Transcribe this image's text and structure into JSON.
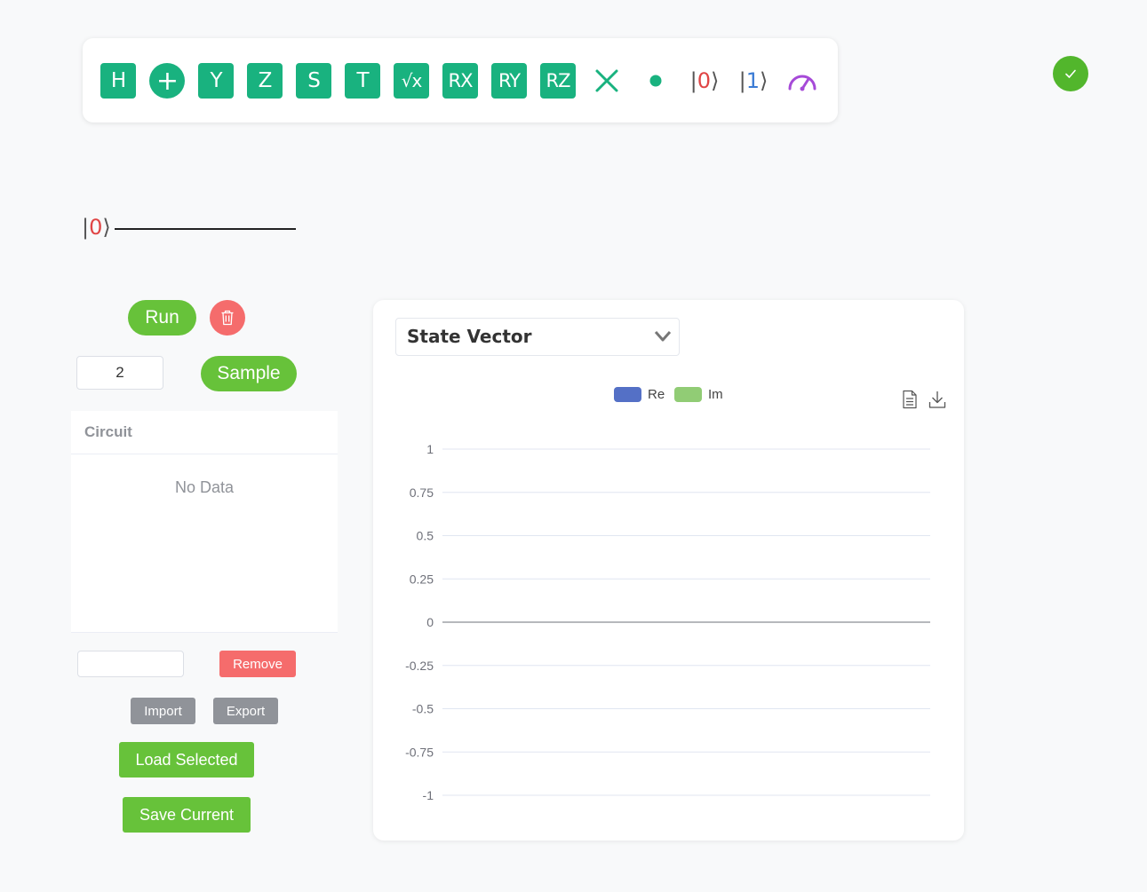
{
  "toolbar": {
    "gates": [
      {
        "label": "H",
        "icon": "hadamard-gate"
      },
      {
        "label": "+",
        "icon": "cnot-target-gate"
      },
      {
        "label": "Y",
        "icon": "pauli-y-gate"
      },
      {
        "label": "Z",
        "icon": "pauli-z-gate"
      },
      {
        "label": "S",
        "icon": "s-gate"
      },
      {
        "label": "T",
        "icon": "t-gate"
      },
      {
        "label": "√x",
        "icon": "sqrt-x-gate"
      },
      {
        "label": "RX",
        "icon": "rx-gate"
      },
      {
        "label": "RY",
        "icon": "ry-gate"
      },
      {
        "label": "RZ",
        "icon": "rz-gate"
      }
    ],
    "ket0": {
      "open": "|",
      "value": "0",
      "close": "⟩"
    },
    "ket1": {
      "open": "|",
      "value": "1",
      "close": "⟩"
    },
    "icons": [
      "swap-x-icon",
      "control-dot-icon",
      "ket-zero-icon",
      "ket-one-icon",
      "measure-gauge-icon"
    ]
  },
  "status": {
    "icon": "check-icon",
    "color": "#52b62c"
  },
  "circuit": {
    "qubit_label": {
      "open": "|",
      "value": "0",
      "close": "⟩"
    }
  },
  "controls": {
    "run_label": "Run",
    "clear_icon": "trash-icon",
    "shots_value": "2",
    "sample_label": "Sample"
  },
  "circuit_table": {
    "header": "Circuit",
    "empty_text": "No Data"
  },
  "actions": {
    "name_value": "",
    "remove_label": "Remove",
    "import_label": "Import",
    "export_label": "Export",
    "load_label": "Load Selected",
    "save_label": "Save Current"
  },
  "chart_panel": {
    "selected_view": "State Vector",
    "toolbox_icons": [
      "data-view-icon",
      "download-icon"
    ]
  },
  "chart_data": {
    "type": "bar",
    "title": "",
    "categories": [],
    "series": [
      {
        "name": "Re",
        "color": "#5470c6",
        "values": []
      },
      {
        "name": "Im",
        "color": "#91cc75",
        "values": []
      }
    ],
    "ylim": [
      -1,
      1
    ],
    "yticks": [
      "1",
      "0.75",
      "0.5",
      "0.25",
      "0",
      "-0.25",
      "-0.5",
      "-0.75",
      "-1"
    ],
    "ytick_values": [
      1,
      0.75,
      0.5,
      0.25,
      0,
      -0.25,
      -0.5,
      -0.75,
      -1
    ],
    "grid": true,
    "legend": "top-center"
  },
  "colors": {
    "gate": "#19b27f",
    "success": "#67c23a",
    "danger": "#f56c6c",
    "info": "#909399",
    "measure": "#a64ad8"
  }
}
